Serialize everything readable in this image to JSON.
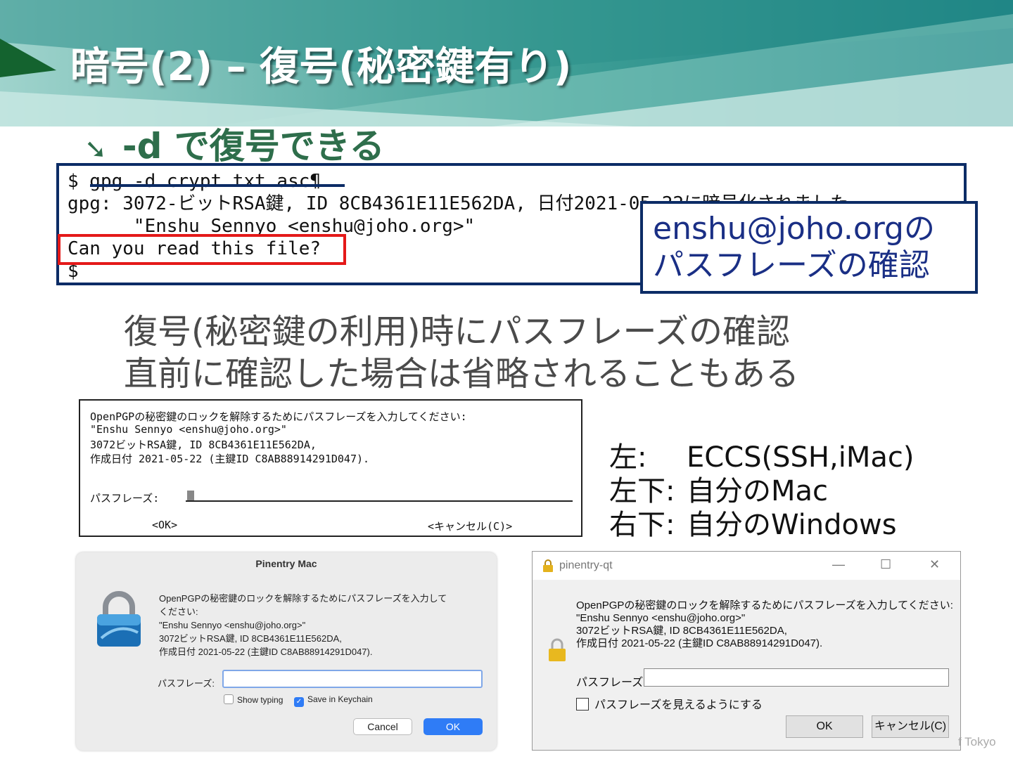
{
  "slide": {
    "title": "暗号(2) – 復号(秘密鍵有り)",
    "subhead": "-d で復号できる",
    "subhead_icon": "arrow-down-right-icon"
  },
  "terminal": {
    "line1": "$ gpg -d crypt.txt.asc¶",
    "line2": "gpg: 3072-ビットRSA鍵, ID 8CB4361E11E562DA, 日付2021-05-22に暗号化されました",
    "line3": "      \"Enshu Sennyo <enshu@joho.org>\"",
    "line4": "Can you read this file?",
    "line5": "$"
  },
  "note": {
    "line1": "enshu@joho.orgの",
    "line2": "パスフレーズの確認"
  },
  "bullets": [
    "復号(秘密鍵の利用)時にパスフレーズの確認",
    "直前に確認した場合は省略されることもある"
  ],
  "curses_dialog": {
    "line1": "OpenPGPの秘密鍵のロックを解除するためにパスフレーズを入力してください:",
    "line2": "\"Enshu Sennyo <enshu@joho.org>\"",
    "line3": "3072ビットRSA鍵, ID 8CB4361E11E562DA,",
    "line4": "作成日付 2021-05-22 (主鍵ID C8AB88914291D047).",
    "pass_label": "パスフレーズ:",
    "ok": "<OK>",
    "cancel": "<キャンセル(C)>"
  },
  "legend": [
    {
      "key": "左:",
      "value": "ECCS(SSH,iMac)"
    },
    {
      "key": "左下:",
      "value": "自分のMac"
    },
    {
      "key": "右下:",
      "value": "自分のWindows"
    }
  ],
  "mac_dialog": {
    "title": "Pinentry Mac",
    "msg1": "OpenPGPの秘密鍵のロックを解除するためにパスフレーズを入力して",
    "msg2": "ください:",
    "msg3": "\"Enshu Sennyo <enshu@joho.org>\"",
    "msg4": "3072ビットRSA鍵, ID 8CB4361E11E562DA,",
    "msg5": "作成日付 2021-05-22 (主鍵ID C8AB88914291D047).",
    "pass_label": "パスフレーズ:",
    "show_typing": "Show typing",
    "save_keychain": "Save in Keychain",
    "cancel": "Cancel",
    "ok": "OK",
    "accent": "#2f7cf6"
  },
  "win_dialog": {
    "title": "pinentry-qt",
    "msg1": "OpenPGPの秘密鍵のロックを解除するためにパスフレーズを入力してください:",
    "msg2": "\"Enshu Sennyo <enshu@joho.org>\"",
    "msg3": "3072ビットRSA鍵, ID 8CB4361E11E562DA,",
    "msg4": "作成日付 2021-05-22 (主鍵ID C8AB88914291D047).",
    "pass_label": "パスフレーズ:",
    "show_pass": "パスフレーズを見えるようにする",
    "ok": "OK",
    "cancel": "キャンセル(C)"
  },
  "footer": "f Tokyo"
}
